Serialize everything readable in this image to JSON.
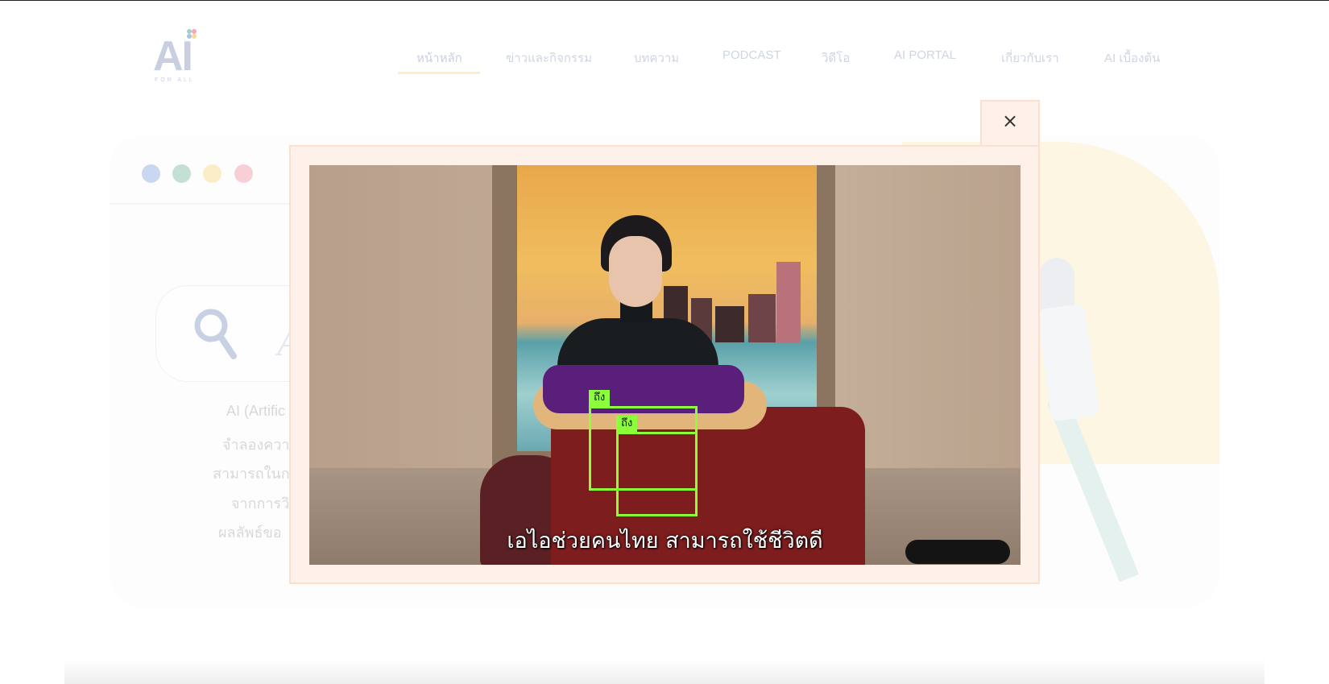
{
  "brand": {
    "logo_text": "AI",
    "logo_subtext": "FOR ALL",
    "logo_dot_colors": [
      "#9fd1c4",
      "#f7a6b9",
      "#a9c2ea",
      "#f9dc8f"
    ]
  },
  "nav": {
    "items": [
      {
        "label": "หน้าหลัก",
        "active": true
      },
      {
        "label": "ข่าวและกิจกรรม",
        "active": false
      },
      {
        "label": "บทความ",
        "active": false
      },
      {
        "label": "PODCAST",
        "active": false
      },
      {
        "label": "วิดีโอ",
        "active": false
      },
      {
        "label": "AI PORTAL",
        "active": false
      },
      {
        "label": "เกี่ยวกับเรา",
        "active": false
      },
      {
        "label": "AI เบื้องต้น",
        "active": false
      }
    ]
  },
  "window_dots": [
    "#c9d8f0",
    "#c4dfd3",
    "#fbedc7",
    "#f8cfd5"
  ],
  "search": {
    "partial_text": "A"
  },
  "description_lines": [
    "AI (Artific",
    "จำลองควา",
    "สามารถในก",
    "จากการวิ",
    "ผลลัพธ์ขอ"
  ],
  "modal": {
    "close_label": "×",
    "video": {
      "subtitle": "เอไอช่วยคนไทย  สามารถใช้ชีวิตดี",
      "detections": [
        {
          "label": "ถึง"
        },
        {
          "label": "ถึง"
        }
      ],
      "detection_color": "#8cff3b"
    }
  },
  "colors": {
    "modal_bg": "#fdf1ea",
    "modal_border": "#fbe0cd",
    "nav_text": "#cfd5e3"
  }
}
